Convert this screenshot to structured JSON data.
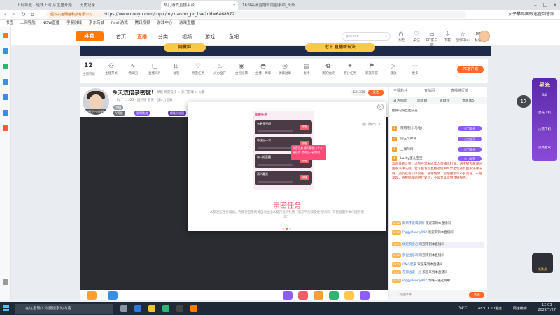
{
  "browser": {
    "tabs": [
      {
        "label": "上网导航 - 轻快上网 从这里开始"
      },
      {
        "label": "历史记录"
      },
      {
        "label": "热门游戏直播平台"
      },
      {
        "label": "16:9高清直播时尚圈事项_头条"
      }
    ],
    "url_site": "超汉头鱼网络科技有限公司",
    "url": "https://www.douyu.com/topic/myxiaozm_pc_live?rid=6468872",
    "addr_right": "女子攀马面眼迷查到答案",
    "bookmarks": [
      "书签",
      "上网导航",
      "NOW直播",
      "手腕融线",
      "京东商城",
      "flash游戏",
      "腾讯视频",
      "游戏中心",
      "游戏直播"
    ]
  },
  "header": {
    "logo": "斗鱼",
    "nav": [
      "首页",
      "直播",
      "分类",
      "视频",
      "游戏",
      "鱼吧"
    ],
    "search_placeholder": "genmin",
    "icons": [
      "历史",
      "关注",
      "PC客户端",
      "下载",
      "创作中心",
      "私信"
    ]
  },
  "banner": {
    "left": "隐藏群",
    "right": "七王 直播新玩法"
  },
  "toolbar": {
    "level": "12",
    "level_label": "主播等级",
    "items": [
      "主播开关",
      "佣兵团",
      "直播间外",
      "福利",
      "亲密任务",
      "火力全开",
      "全民投票",
      "主播一周年",
      "弹幕勋章",
      "发卡",
      "我的抽奖",
      "积分任务",
      "家族荣誉",
      "播放",
      "更多"
    ],
    "pc_btn": "PC客户端"
  },
  "room": {
    "title": "今天双倍亲密度!",
    "meta": "举报  网游竞技 > 热门游戏 > 火影",
    "meta2": "LV.7  11525  · 送礼物 有奖 · 战斗力指数",
    "chips": [
      "主播",
      "V贵族",
      "福利挑战",
      "超级粉丝团"
    ],
    "avatar_tag": "热门一小时榜",
    "follow_count": "121336",
    "follow": "关注"
  },
  "modal": {
    "close": "×",
    "exit": "窗口弹出",
    "mission_header": "亲密任务",
    "missions": [
      {
        "title": "有更多不断",
        "btn": "领取"
      },
      {
        "title": "每送出一次",
        "btn": "领取"
      },
      {
        "title": "每一把直播",
        "btn": "领取"
      },
      {
        "title": "两个嘉奖",
        "btn": "领取"
      }
    ],
    "tip": "亲密任务 即可解锁 3个亲密任务 完成后一键领取",
    "title": "亲密任务",
    "desc": "水友发起任务邀请，完成便后系统将自动送出水友预设的礼物（若您不想接受任务订阅，可在设置中关闭任务管理）",
    "prev": "‹",
    "next": "›"
  },
  "chat": {
    "tabs": [
      "主播粉丝",
      "直播间",
      "直播排行榜"
    ],
    "rank_tabs": [
      "日活贡献",
      "周贡献",
      "贡献榜",
      "贵宾(65)"
    ],
    "rank_intro": "接受的粉丝团成员",
    "ranks": [
      {
        "no": "1",
        "name": "哦哦哦(小乌龟)",
        "badge": "火力全开"
      },
      {
        "no": "2",
        "name": "闹五个帅哥",
        "badge": "火力全开"
      },
      {
        "no": "3",
        "name": "上线的吗",
        "badge": "火力全开"
      },
      {
        "no": "4",
        "name": "Lucky蛋儿宝宝",
        "badge": "火力全开"
      }
    ],
    "notice": "欢迎来到斗鱼！斗鱼严禁未成年人直播或打赏，请主播大家遵守国家法律法规。若斗鱼发现直播过程中严禁出现违反国家法律法规、违反社会公序良俗、低俗色情、吸烟酗酒等不良内容，一经发现，将根据规则进行处罚，不得为其提供直播服务。",
    "messages": [
      {
        "lv": "LV.12",
        "user": "斯斯不爱喝斯斯",
        "text": "欢迎来到本直播间"
      },
      {
        "lv": "LV.12",
        "user": "PiggyBunny942",
        "text": "欢迎来到本直播间"
      },
      {
        "lv": "LV.5",
        "user": "搞定机会必",
        "text": "欢迎来到本直播间"
      },
      {
        "lv": "LV.12",
        "user": "梦里出乐啊",
        "text": "欢迎来到本直播间"
      },
      {
        "lv": "LV.12",
        "user": "OMG起来",
        "text": "欢迎来到本直播间"
      },
      {
        "lv": "LV.4",
        "user": "在那边说一起",
        "text": "欢迎来到本直播间"
      },
      {
        "lv": "LV.12",
        "user": "PiggyBunny942",
        "text": "为唯一遍选择中"
      }
    ],
    "input_placeholder": "发送弹幕",
    "send": "发送"
  },
  "side": {
    "ad_title": "星光",
    "ad_lines": [
      "3/0",
      "星光飞机",
      "火箭飞机",
      "点亮喜欢"
    ],
    "badge": "17",
    "mascot": "新挑战"
  },
  "taskbar": {
    "search_placeholder": "在这里输入你要搜索的内容",
    "temp": "34°C",
    "cpu": "48°C CPU温度",
    "tray_label": "网速编辑",
    "time": "12:03",
    "date": "2022/7/27"
  },
  "colors": {
    "accent": "#ff5d23",
    "chat_badge": "#8b5cf6",
    "taskbar": "#1f2a38"
  }
}
